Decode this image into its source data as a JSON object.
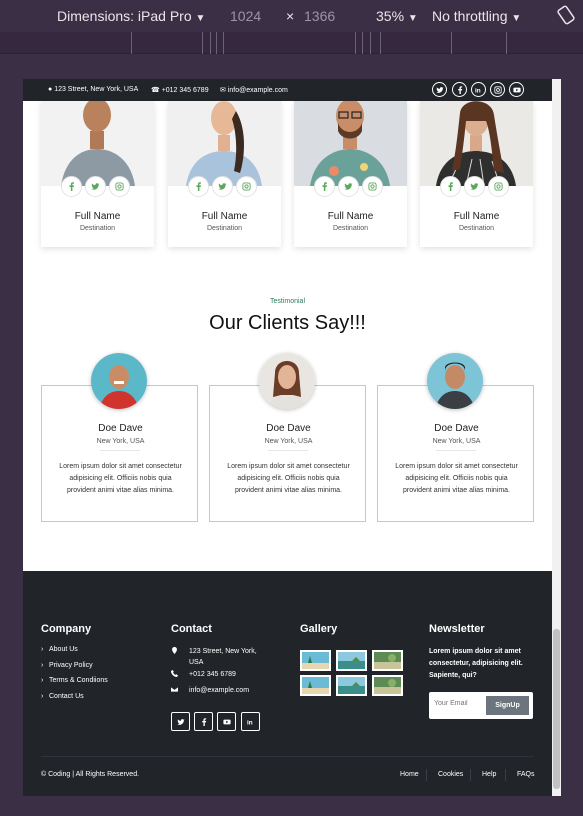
{
  "devtools": {
    "dimensions_label": "Dimensions: iPad Pro",
    "width": "1024",
    "times": "×",
    "height": "1366",
    "zoom": "35%",
    "throttling": "No throttling"
  },
  "topbar": {
    "address": "123 Street, New York, USA",
    "phone": "+012 345 6789",
    "email": "info@example.com",
    "socials": [
      "twitter-icon",
      "facebook-icon",
      "linkedin-icon",
      "instagram-icon",
      "youtube-icon"
    ]
  },
  "team": [
    {
      "name": "Full Name",
      "role": "Destination"
    },
    {
      "name": "Full Name",
      "role": "Destination"
    },
    {
      "name": "Full Name",
      "role": "Destination"
    },
    {
      "name": "Full Name",
      "role": "Destination"
    }
  ],
  "testimonial": {
    "subtitle": "Testimonial",
    "heading": "Our Clients Say!!!",
    "items": [
      {
        "name": "Doe Dave",
        "location": "New York, USA",
        "text": "Lorem ipsum dolor sit amet consectetur adipisicing elit. Officiis nobis quia provident animi vitae alias minima."
      },
      {
        "name": "Doe Dave",
        "location": "New York, USA",
        "text": "Lorem ipsum dolor sit amet consectetur adipisicing elit. Officiis nobis quia provident animi vitae alias minima."
      },
      {
        "name": "Doe Dave",
        "location": "New York, USA",
        "text": "Lorem ipsum dolor sit amet consectetur adipisicing elit. Officiis nobis quia provident animi vitae alias minima."
      }
    ]
  },
  "footer": {
    "company": {
      "title": "Company",
      "links": [
        "About Us",
        "Privacy Policy",
        "Terms & Condiions",
        "Contact Us"
      ]
    },
    "contact": {
      "title": "Contact",
      "address": "123 Street, New York, USA",
      "phone": "+012 345 6789",
      "email": "info@example.com"
    },
    "gallery": {
      "title": "Gallery"
    },
    "newsletter": {
      "title": "Newsletter",
      "text": "Lorem ipsum dolor sit amet consectetur, adipisicing elit. Sapiente, qui?",
      "placeholder": "Your Email",
      "button": "SignUp"
    },
    "copyright_prefix": "© ",
    "copyright_brand": "Coding",
    "copyright_suffix": " | All Rights Reserved.",
    "bottom_links": [
      "Home",
      "Cookies",
      "Help",
      "FAQs"
    ]
  },
  "colors": {
    "dark": "#212529",
    "accent_green": "#2e7d5b",
    "card_border": "#a9d6c8",
    "button_gray": "#6c757d"
  }
}
